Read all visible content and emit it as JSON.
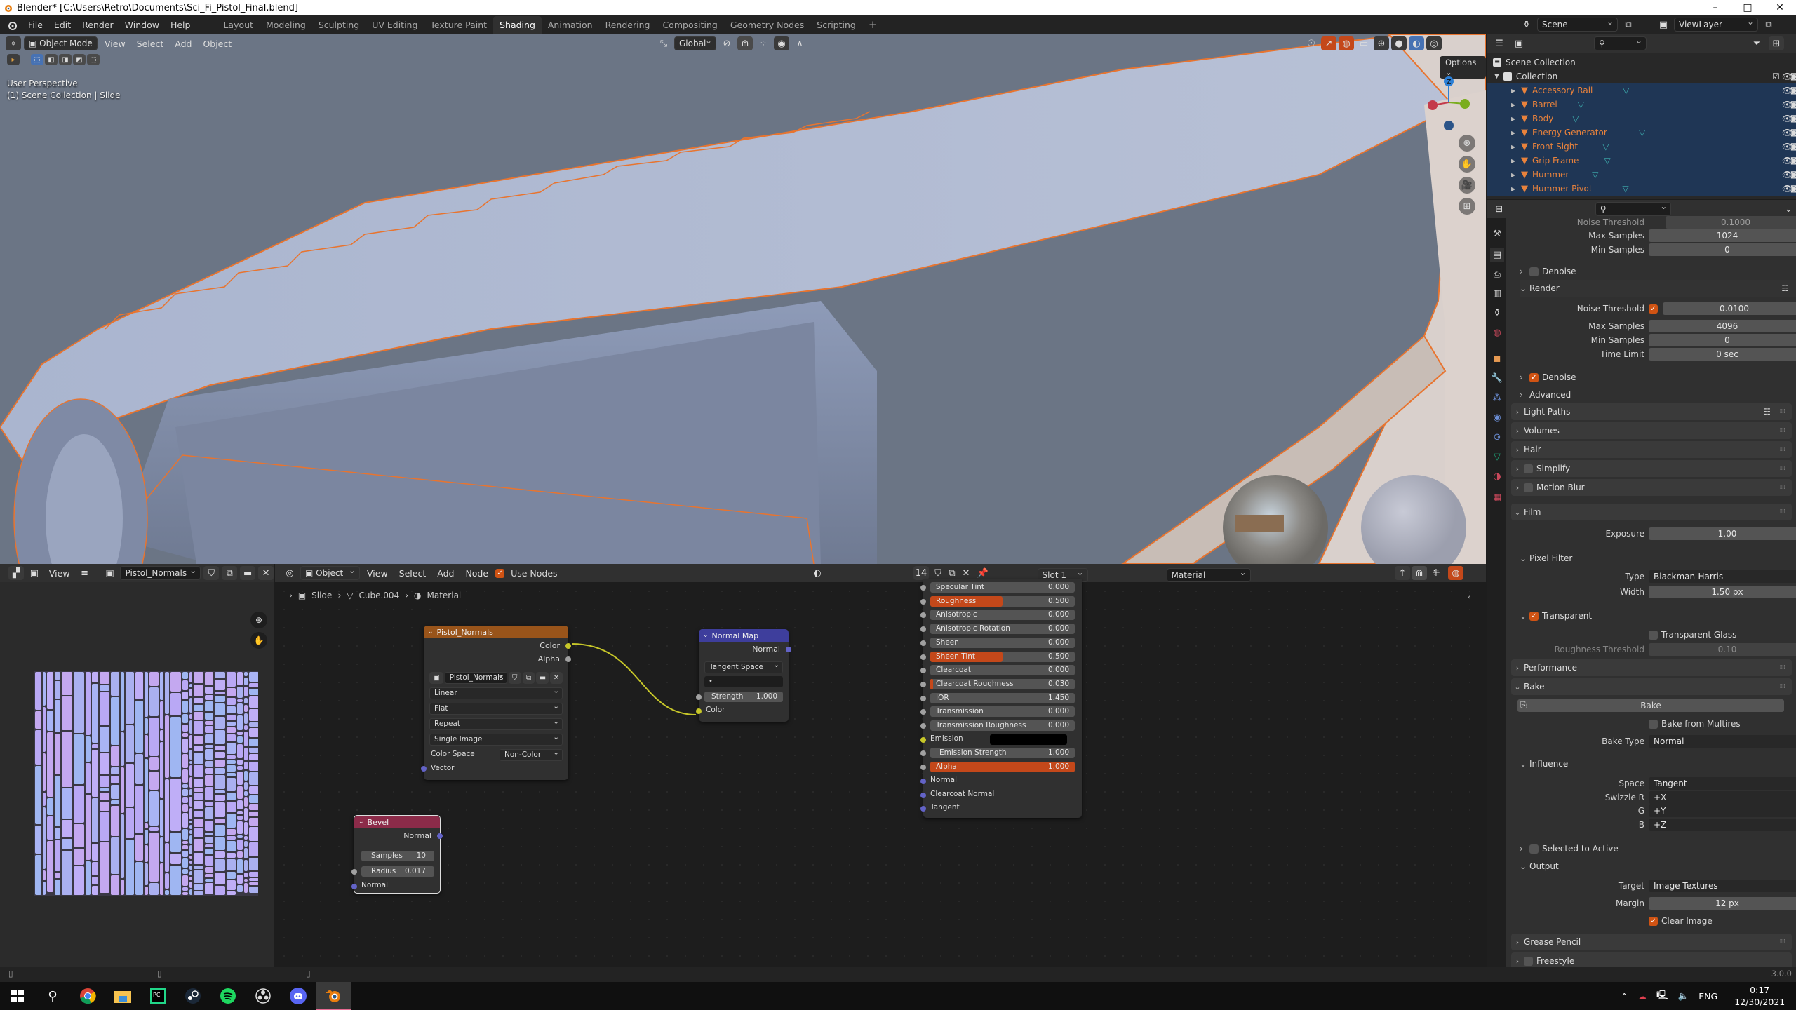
{
  "window": {
    "title": "Blender* [C:\\Users\\Retro\\Documents\\Sci_Fi_Pistol_Final.blend]",
    "controls": {
      "minimize": "–",
      "maximize": "□",
      "close": "✕"
    }
  },
  "menubar": {
    "menus": [
      "File",
      "Edit",
      "Render",
      "Window",
      "Help"
    ],
    "workspaces": [
      "Layout",
      "Modeling",
      "Sculpting",
      "UV Editing",
      "Texture Paint",
      "Shading",
      "Animation",
      "Rendering",
      "Compositing",
      "Geometry Nodes",
      "Scripting"
    ],
    "active_workspace": "Shading",
    "add_workspace": "+",
    "scene": "Scene",
    "view_layer": "ViewLayer"
  },
  "viewport": {
    "header": {
      "mode": "Object Mode",
      "menus": [
        "View",
        "Select",
        "Add",
        "Object"
      ],
      "transform_orientation": "Global",
      "options": "Options"
    },
    "overlay": {
      "view_name": "User Perspective",
      "context": "(1) Scene Collection | Slide"
    },
    "gizmo": {
      "z_label": "Z"
    }
  },
  "outliner": {
    "search_placeholder": "",
    "scene_collection": "Scene Collection",
    "collection": "Collection",
    "items": [
      "Accessory Rail",
      "Barrel",
      "Body",
      "Energy Generator",
      "Front Sight",
      "Grip Frame",
      "Hummer",
      "Hummer Pivot"
    ]
  },
  "properties": {
    "partial_top": {
      "label": "Noise Threshold",
      "value": "0.1000"
    },
    "viewport_samples": [
      {
        "label": "Max Samples",
        "value": "1024"
      },
      {
        "label": "Min Samples",
        "value": "0"
      }
    ],
    "viewport_denoise": {
      "label": "Denoise",
      "checked": false
    },
    "render_section": "Render",
    "noise_threshold": {
      "label": "Noise Threshold",
      "checked": true,
      "value": "0.0100"
    },
    "render_samples": [
      {
        "label": "Max Samples",
        "value": "4096"
      },
      {
        "label": "Min Samples",
        "value": "0"
      },
      {
        "label": "Time Limit",
        "value": "0 sec"
      }
    ],
    "render_denoise": {
      "label": "Denoise",
      "checked": true
    },
    "advanced": "Advanced",
    "sections_collapsed": [
      {
        "label": "Light Paths",
        "has_checkbox": false
      },
      {
        "label": "Volumes",
        "has_checkbox": false
      },
      {
        "label": "Hair",
        "has_checkbox": false
      },
      {
        "label": "Simplify",
        "has_checkbox": true
      },
      {
        "label": "Motion Blur",
        "has_checkbox": true
      }
    ],
    "film": {
      "label": "Film",
      "exposure": {
        "label": "Exposure",
        "value": "1.00"
      },
      "pixel_filter": "Pixel Filter",
      "type": {
        "label": "Type",
        "value": "Blackman-Harris"
      },
      "width": {
        "label": "Width",
        "value": "1.50 px"
      },
      "transparent": {
        "label": "Transparent",
        "checked": true
      },
      "transparent_glass": {
        "label": "Transparent Glass",
        "checked": false
      },
      "roughness_threshold": {
        "label": "Roughness Threshold",
        "value": "0.10"
      }
    },
    "performance": "Performance",
    "bake": {
      "label": "Bake",
      "bake_button": "Bake",
      "bake_from_multires": {
        "label": "Bake from Multires",
        "checked": false
      },
      "bake_type": {
        "label": "Bake Type",
        "value": "Normal"
      },
      "influence": "Influence",
      "space": {
        "label": "Space",
        "value": "Tangent"
      },
      "swizzle_r": {
        "label": "Swizzle R",
        "value": "+X"
      },
      "swizzle_g": {
        "label": "G",
        "value": "+Y"
      },
      "swizzle_b": {
        "label": "B",
        "value": "+Z"
      },
      "selected_to_active": {
        "label": "Selected to Active",
        "checked": false
      },
      "output": "Output",
      "target": {
        "label": "Target",
        "value": "Image Textures"
      },
      "margin": {
        "label": "Margin",
        "value": "12 px"
      },
      "clear_image": {
        "label": "Clear Image",
        "checked": true
      }
    },
    "grease_pencil": "Grease Pencil",
    "freestyle": "Freestyle"
  },
  "image_editor": {
    "view_menu": "View",
    "image_name": "Pistol_Normals"
  },
  "node_editor": {
    "header": {
      "object": "Object",
      "menus": [
        "View",
        "Select",
        "Add",
        "Node"
      ],
      "use_nodes": "Use Nodes",
      "slot": "Slot 1",
      "material": "Material",
      "users": "14"
    },
    "breadcrumb": [
      "Slide",
      "Cube.004",
      "Material"
    ],
    "image_node": {
      "title": "Pistol_Normals",
      "outputs": [
        "Color",
        "Alpha"
      ],
      "image": "Pistol_Normals",
      "interpolation": "Linear",
      "projection": "Flat",
      "extension": "Repeat",
      "source": "Single Image",
      "color_space_label": "Color Space",
      "color_space": "Non-Color",
      "input": "Vector"
    },
    "normal_map_node": {
      "title": "Normal Map",
      "output": "Normal",
      "space": "Tangent Space",
      "uv_map": "•",
      "strength_label": "Strength",
      "strength": "1.000",
      "input": "Color"
    },
    "bevel_node": {
      "title": "Bevel",
      "output": "Normal",
      "samples_label": "Samples",
      "samples": "10",
      "radius_label": "Radius",
      "radius": "0.017",
      "input": "Normal"
    },
    "bsdf_rows": [
      {
        "label": "Specular Tint",
        "value": "0.000",
        "fill": 0
      },
      {
        "label": "Roughness",
        "value": "0.500",
        "fill": 0.5
      },
      {
        "label": "Anisotropic",
        "value": "0.000",
        "fill": 0
      },
      {
        "label": "Anisotropic Rotation",
        "value": "0.000",
        "fill": 0
      },
      {
        "label": "Sheen",
        "value": "0.000",
        "fill": 0
      },
      {
        "label": "Sheen Tint",
        "value": "0.500",
        "fill": 0.5
      },
      {
        "label": "Clearcoat",
        "value": "0.000",
        "fill": 0
      },
      {
        "label": "Clearcoat Roughness",
        "value": "0.030",
        "fill": 0.03
      },
      {
        "label": "IOR",
        "value": "1.450",
        "fill": 0
      },
      {
        "label": "Transmission",
        "value": "0.000",
        "fill": 0
      },
      {
        "label": "Transmission Roughness",
        "value": "0.000",
        "fill": 0
      }
    ],
    "bsdf_emission": "Emission",
    "bsdf_emission_strength": {
      "label": "Emission Strength",
      "value": "1.000"
    },
    "bsdf_alpha": {
      "label": "Alpha",
      "value": "1.000",
      "fill": 1
    },
    "bsdf_vectors": [
      "Normal",
      "Clearcoat Normal",
      "Tangent"
    ]
  },
  "statusbar": {
    "version": "3.0.0"
  },
  "taskbar": {
    "apps": [
      "start",
      "search",
      "chrome",
      "file-explorer",
      "pycharm",
      "steam",
      "spotify",
      "obs",
      "discord",
      "blender"
    ],
    "language": "ENG",
    "time": "0:17",
    "date": "12/30/2021"
  },
  "colors": {
    "accent_orange": "#d05313",
    "selection_blue": "#1f3655",
    "object_orange": "#e8823c",
    "mesh_teal": "#3fb3b3",
    "image_node_header": "#99541a",
    "normal_map_header": "#3e3e9c",
    "bevel_header": "#8c2b49"
  }
}
